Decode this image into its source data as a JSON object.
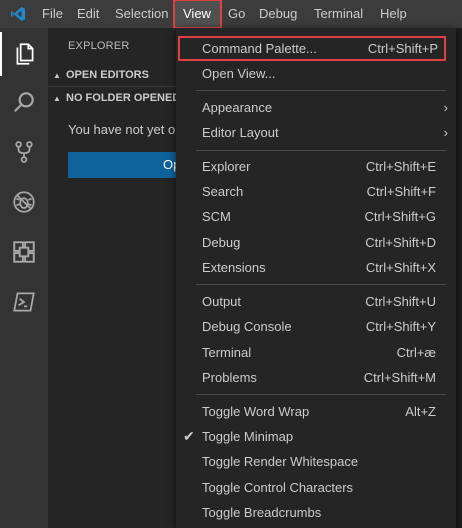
{
  "menubar": {
    "items": [
      "File",
      "Edit",
      "Selection",
      "View",
      "Go",
      "Debug",
      "Terminal",
      "Help"
    ],
    "active": "View"
  },
  "activitybar": {
    "icons": [
      "files-icon",
      "search-icon",
      "source-control-icon",
      "debug-icon",
      "extensions-icon",
      "terminal-icon"
    ]
  },
  "sidebar": {
    "title": "EXPLORER",
    "sections": [
      "OPEN EDITORS",
      "NO FOLDER OPENED"
    ],
    "message": "You have not yet opened a folder.",
    "button_label": "Open Folder"
  },
  "view_menu": {
    "groups": [
      [
        {
          "label": "Command Palette...",
          "shortcut": "Ctrl+Shift+P"
        },
        {
          "label": "Open View...",
          "shortcut": ""
        }
      ],
      [
        {
          "label": "Appearance",
          "submenu": true
        },
        {
          "label": "Editor Layout",
          "submenu": true
        }
      ],
      [
        {
          "label": "Explorer",
          "shortcut": "Ctrl+Shift+E"
        },
        {
          "label": "Search",
          "shortcut": "Ctrl+Shift+F"
        },
        {
          "label": "SCM",
          "shortcut": "Ctrl+Shift+G"
        },
        {
          "label": "Debug",
          "shortcut": "Ctrl+Shift+D"
        },
        {
          "label": "Extensions",
          "shortcut": "Ctrl+Shift+X"
        }
      ],
      [
        {
          "label": "Output",
          "shortcut": "Ctrl+Shift+U"
        },
        {
          "label": "Debug Console",
          "shortcut": "Ctrl+Shift+Y"
        },
        {
          "label": "Terminal",
          "shortcut": "Ctrl+æ"
        },
        {
          "label": "Problems",
          "shortcut": "Ctrl+Shift+M"
        }
      ],
      [
        {
          "label": "Toggle Word Wrap",
          "shortcut": "Alt+Z"
        },
        {
          "label": "Toggle Minimap",
          "shortcut": "",
          "checked": true
        },
        {
          "label": "Toggle Render Whitespace",
          "shortcut": ""
        },
        {
          "label": "Toggle Control Characters",
          "shortcut": ""
        },
        {
          "label": "Toggle Breadcrumbs",
          "shortcut": ""
        }
      ]
    ]
  },
  "colors": {
    "accent": "#0e639c",
    "highlight_outline": "#e04040",
    "logo": "#2489ca"
  }
}
